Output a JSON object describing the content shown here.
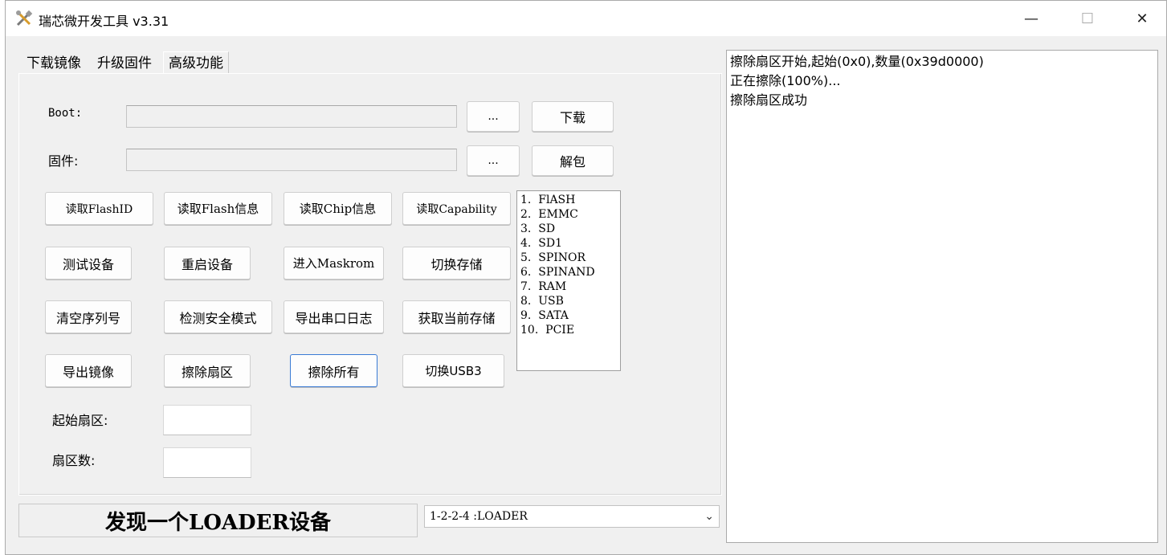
{
  "window": {
    "title": "瑞芯微开发工具 v3.31",
    "icon": "tools-icon",
    "controls": {
      "minimize": "—",
      "maximize": "☐",
      "close": "✕"
    }
  },
  "tabs": [
    {
      "label": "下载镜像",
      "active": false
    },
    {
      "label": "升级固件",
      "active": false
    },
    {
      "label": "高级功能",
      "active": true
    }
  ],
  "boot": {
    "label": "Boot:",
    "value": "",
    "browse_label": "...",
    "action_label": "下载"
  },
  "firmware": {
    "label": "固件:",
    "value": "",
    "browse_label": "...",
    "action_label": "解包"
  },
  "buttons": {
    "read_flash_id": "读取FlashID",
    "read_flash_info": "读取Flash信息",
    "read_chip_info": "读取Chip信息",
    "read_capability": "读取Capability",
    "test_device": "测试设备",
    "reboot_device": "重启设备",
    "enter_maskrom": "进入Maskrom",
    "switch_storage": "切换存储",
    "clear_serial": "清空序列号",
    "detect_secure_mode": "检测安全模式",
    "export_serial_log": "导出串口日志",
    "get_current_storage": "获取当前存储",
    "export_image": "导出镜像",
    "erase_sectors": "擦除扇区",
    "erase_all": "擦除所有",
    "switch_usb3": "切换USB3"
  },
  "storage_list": [
    "1.  FlASH",
    "2.  EMMC",
    "3.  SD",
    "4.  SD1",
    "5.  SPINOR",
    "6.  SPINAND",
    "7.  RAM",
    "8.  USB",
    "9.  SATA",
    "10.  PCIE"
  ],
  "sector": {
    "start_label": "起始扇区:",
    "start_value": "",
    "count_label": "扇区数:",
    "count_value": ""
  },
  "status": {
    "text": "发现一个LOADER设备"
  },
  "device_select": {
    "value": "1-2-2-4  :LOADER"
  },
  "log": [
    "擦除扇区开始,起始(0x0),数量(0x39d0000)",
    "正在擦除(100%)...",
    "擦除扇区成功"
  ]
}
